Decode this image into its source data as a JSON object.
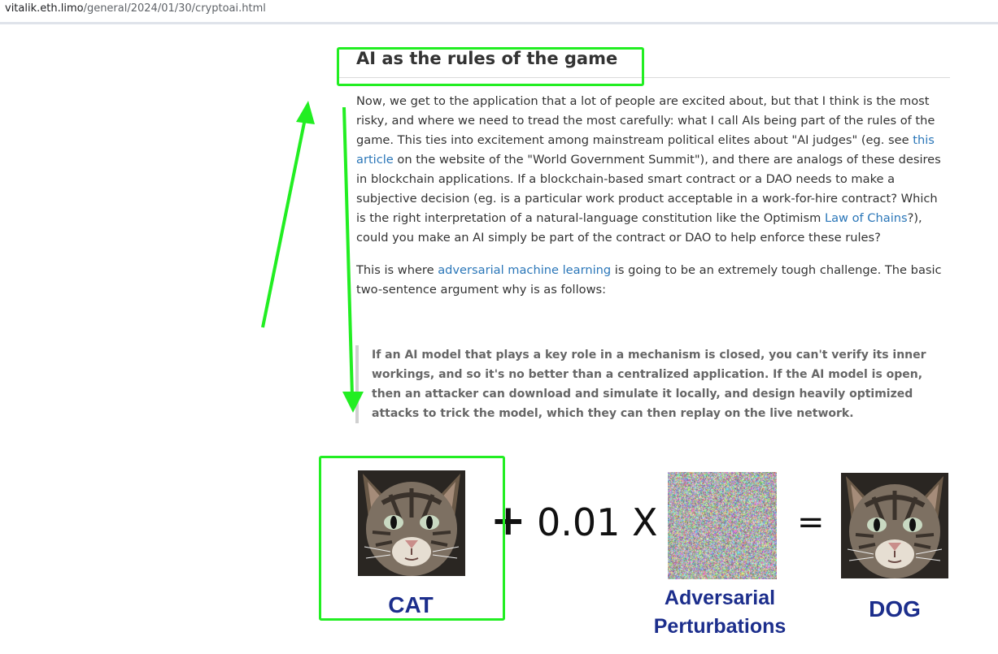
{
  "browser": {
    "url_host": "vitalik.eth.limo",
    "url_path": "/general/2024/01/30/cryptoai.html"
  },
  "article": {
    "heading": "AI as the rules of the game",
    "p1": {
      "t1": "Now, we get to the application that a lot of people are excited about, but that I think is the most risky, and where we need to tread the most carefully: what I call AIs being part of the rules of the game. This ties into excitement among mainstream political elites about \"AI judges\" (eg. see ",
      "link1": "this article",
      "t2": " on the website of the \"World Government Summit\"), and there are analogs of these desires in blockchain applications. If a blockchain-based smart contract or a DAO needs to make a subjective decision (eg. is a particular work product acceptable in a work-for-hire contract? Which is the right interpretation of a natural-language constitution like the Optimism ",
      "link2": "Law of Chains",
      "t3": "?), could you make an AI simply be part of the contract or DAO to help enforce these rules?"
    },
    "p2": {
      "t1": "This is where ",
      "link1": "adversarial machine learning",
      "t2": " is going to be an extremely tough challenge. The basic two-sentence argument why is as follows:"
    },
    "quote": "If an AI model that plays a key role in a mechanism is closed, you can't verify its inner workings, and so it's no better than a centralized application. If the AI model is open, then an attacker can download and simulate it locally, and design heavily optimized attacks to trick the model, which they can then replay on the live network."
  },
  "figure": {
    "plus": "+",
    "coefficient": "0.01 X",
    "equals": "=",
    "cat_label": "CAT",
    "noise_label_line1": "Adversarial",
    "noise_label_line2": "Perturbations",
    "dog_label": "DOG"
  },
  "annotations": {
    "color": "#22ee22"
  },
  "colors": {
    "link": "#2a76b8",
    "caption": "#1c2e8c",
    "text": "#333333"
  }
}
